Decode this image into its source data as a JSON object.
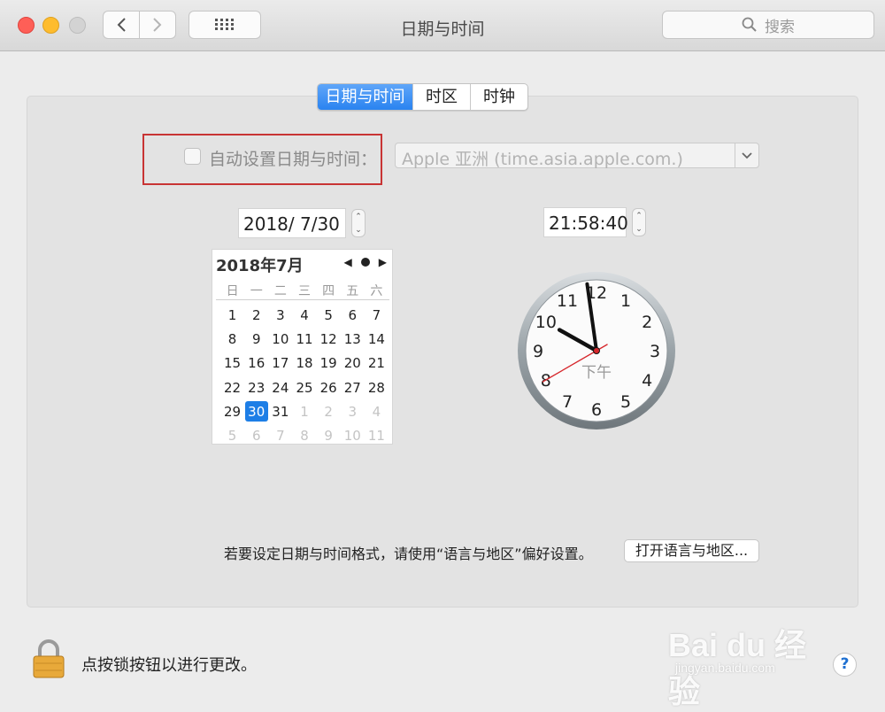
{
  "window": {
    "title": "日期与时间"
  },
  "toolbar": {
    "search_placeholder": "搜索"
  },
  "tabs": [
    {
      "label": "日期与时间",
      "active": true
    },
    {
      "label": "时区",
      "active": false
    },
    {
      "label": "时钟",
      "active": false
    }
  ],
  "auto": {
    "label": "自动设置日期与时间：",
    "checked": false,
    "server_value": "Apple 亚洲 (time.asia.apple.com.)"
  },
  "date_field": {
    "value": "2018/  7/30"
  },
  "time_field": {
    "value": "21:58:40"
  },
  "calendar": {
    "title": "2018年7月",
    "weekdays": [
      "日",
      "一",
      "二",
      "三",
      "四",
      "五",
      "六"
    ],
    "days": [
      [
        "1",
        "2",
        "3",
        "4",
        "5",
        "6",
        "7"
      ],
      [
        "8",
        "9",
        "10",
        "11",
        "12",
        "13",
        "14"
      ],
      [
        "15",
        "16",
        "17",
        "18",
        "19",
        "20",
        "21"
      ],
      [
        "22",
        "23",
        "24",
        "25",
        "26",
        "27",
        "28"
      ],
      [
        "29",
        "30",
        "31",
        "1",
        "2",
        "3",
        "4"
      ],
      [
        "5",
        "6",
        "7",
        "8",
        "9",
        "10",
        "11"
      ]
    ],
    "selected_day": "30"
  },
  "clock": {
    "numbers": [
      "12",
      "1",
      "2",
      "3",
      "4",
      "5",
      "6",
      "7",
      "8",
      "9",
      "10",
      "11"
    ],
    "ampm": "下午",
    "hours": 21,
    "minutes": 58,
    "seconds": 40
  },
  "format_hint": "若要设定日期与时间格式，请使用“语言与地区”偏好设置。",
  "open_button": "打开语言与地区...",
  "lock_text": "点按锁按钮以进行更改。",
  "help_label": "?",
  "watermark": {
    "main": "Bai du 经验",
    "sub": "jingyan.baidu.com"
  }
}
